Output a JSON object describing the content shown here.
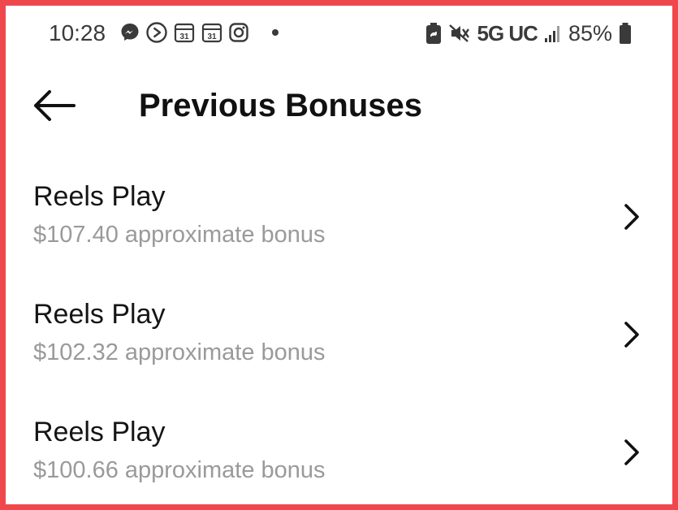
{
  "status_bar": {
    "time": "10:28",
    "left_icons": [
      "messenger-icon",
      "tv-play-icon",
      "calendar-icon",
      "calendar-icon",
      "instagram-icon",
      "notification-dot"
    ],
    "calendar_day": "31",
    "right_icons": [
      "battery-saver-icon",
      "vibrate-mute-icon",
      "signal-icon",
      "battery-icon"
    ],
    "network": "5G UC",
    "battery": "85%"
  },
  "header": {
    "back_icon": "arrow-left-icon",
    "title": "Previous Bonuses"
  },
  "bonuses": [
    {
      "title": "Reels Play",
      "subtitle": "$107.40 approximate bonus"
    },
    {
      "title": "Reels Play",
      "subtitle": "$102.32 approximate bonus"
    },
    {
      "title": "Reels Play",
      "subtitle": "$100.66 approximate bonus"
    }
  ],
  "colors": {
    "frame_border": "#f0474c",
    "title_text": "#111111",
    "subtitle_text": "#9a9a9a",
    "status_text": "#3a3a3a"
  }
}
